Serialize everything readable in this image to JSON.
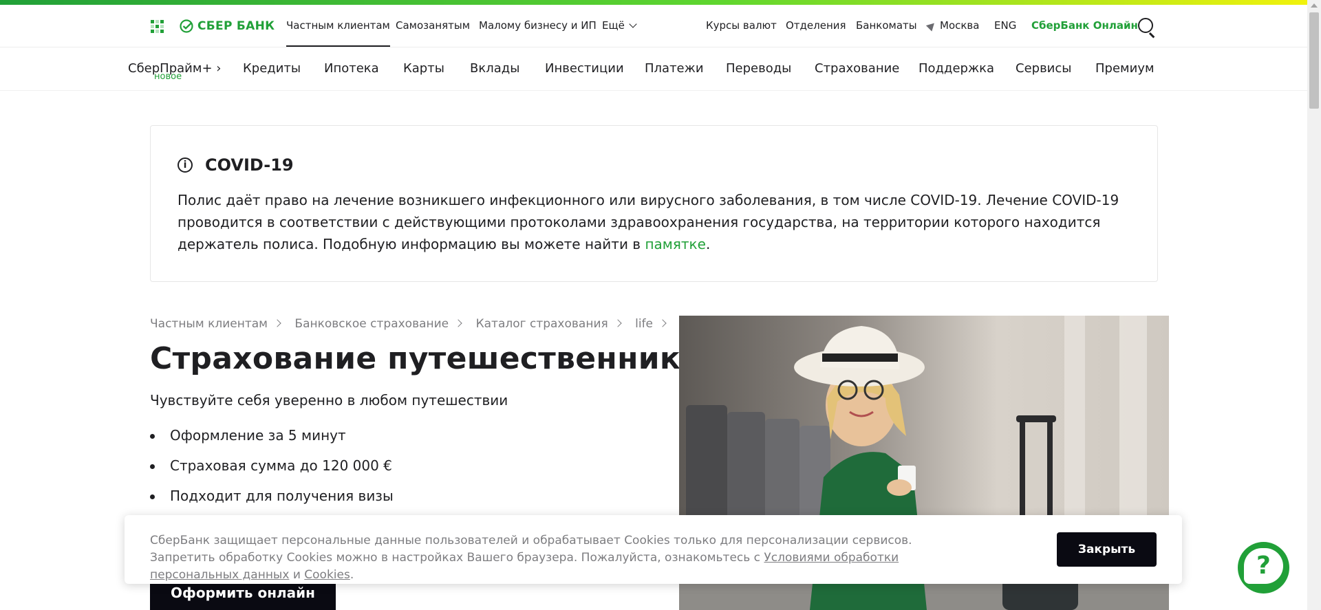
{
  "brand": {
    "name": "СБЕР БАНК",
    "accent_color": "#21a038"
  },
  "header_top": {
    "segments": [
      "Частным клиентам",
      "Самозанятым",
      "Малому бизнесу и ИП",
      "Ещё"
    ],
    "right_links": {
      "rates": "Курсы валют",
      "branches": "Отделения",
      "atms": "Банкоматы",
      "city": "Москва",
      "lang": "ENG",
      "online": "СберБанк Онлайн"
    }
  },
  "header_main": {
    "prime": {
      "label": "СберПрайм+ ›",
      "badge": "новое"
    },
    "items": [
      "Кредиты",
      "Ипотека",
      "Карты",
      "Вклады",
      "Инвестиции",
      "Платежи",
      "Переводы",
      "Страхование",
      "Поддержка",
      "Сервисы",
      "Премиум"
    ]
  },
  "notice": {
    "title": "COVID-19",
    "text": "Полис даёт право на лечение возникшего инфекционного или вирусного заболевания, в том числе COVID-19. Лечение COVID-19 проводится в соответствии с действующими протоколами здравоохранения государства, на территории которого находится держатель полиса. Подобную информацию вы можете найти в ",
    "link": "памятке",
    "end": "."
  },
  "breadcrumb": [
    "Частным клиентам",
    "Банковское страхование",
    "Каталог страхования",
    "life"
  ],
  "product": {
    "title": "Страхование путешественников",
    "subtitle": "Чувствуйте себя уверенно в любом путешествии",
    "features": [
      "Оформление за 5 минут",
      "Страховая сумма до 120 000 €",
      "Подходит для получения визы"
    ],
    "cta": "Оформить онлайн"
  },
  "cookie": {
    "text": "СберБанк защищает персональные данные пользователей и обрабатывает Cookies только для персонализации сервисов. Запретить обработку Cookies можно в настройках Вашего браузера. Пожалуйста, ознакомьтесь с ",
    "link1": "Условиями обработки персональных данных",
    "and": " и ",
    "link2": "Cookies",
    "end": ".",
    "close": "Закрыть"
  },
  "help": {
    "glyph": "?"
  }
}
